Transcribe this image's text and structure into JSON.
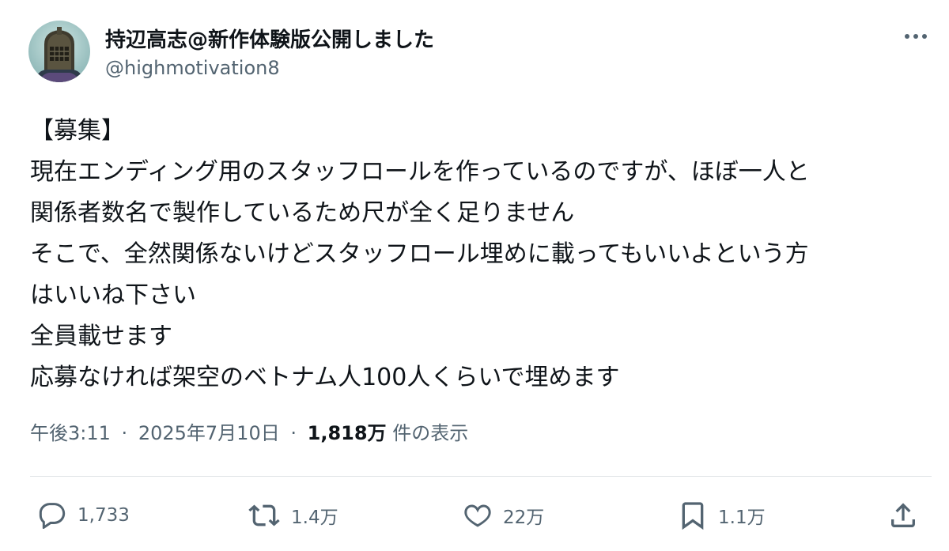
{
  "author": {
    "display_name": "持辺高志@新作体験版公開しました",
    "handle": "@highmotivation8",
    "avatar": "knight-helmet-avatar"
  },
  "more_icon": "more-horizontal-icon",
  "body_lines": [
    "【募集】",
    "現在エンディング用のスタッフロールを作っているのですが、ほぼ一人と",
    "関係者数名で製作しているため尺が全く足りません",
    "そこで、全然関係ないけどスタッフロール埋めに載ってもいいよという方",
    "はいいね下さい",
    "全員載せます",
    "応募なければ架空のベトナム人100人くらいで埋めます"
  ],
  "meta": {
    "time": "午後3:11",
    "separator": "·",
    "date": "2025年7月10日",
    "views_count": "1,818万",
    "views_label": "件の表示"
  },
  "actions": {
    "reply": {
      "icon": "reply-icon",
      "count": "1,733"
    },
    "retweet": {
      "icon": "retweet-icon",
      "count": "1.4万"
    },
    "like": {
      "icon": "heart-icon",
      "count": "22万"
    },
    "bookmark": {
      "icon": "bookmark-icon",
      "count": "1.1万"
    },
    "share": {
      "icon": "share-icon"
    }
  },
  "colors": {
    "text_primary": "#0f1419",
    "text_secondary": "#536471",
    "divider": "#dfe3e6",
    "background": "#ffffff"
  }
}
